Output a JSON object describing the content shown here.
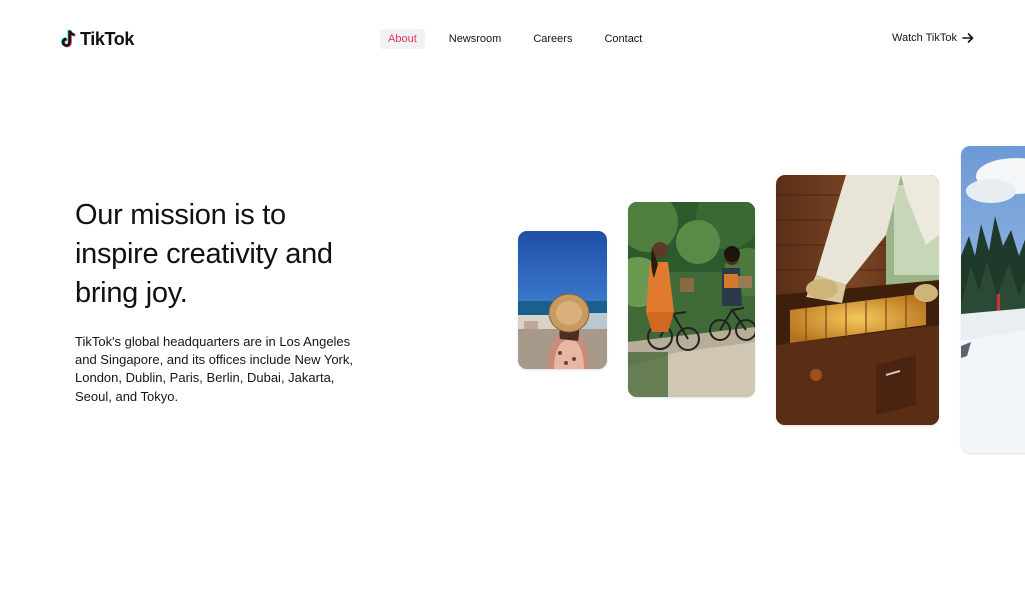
{
  "brand": {
    "name": "TikTok",
    "icon": "tiktok-note-icon",
    "colors": {
      "cyan": "#25F4EE",
      "pink": "#FE2C55",
      "ink": "#111111"
    }
  },
  "nav": {
    "items": [
      {
        "label": "About",
        "active": true
      },
      {
        "label": "Newsroom",
        "active": false
      },
      {
        "label": "Careers",
        "active": false
      },
      {
        "label": "Contact",
        "active": false
      }
    ],
    "active_color": "#E0395A"
  },
  "watch_cta": {
    "label": "Watch TikTok",
    "icon": "arrow-right-icon"
  },
  "hero": {
    "headline": "Our mission is to inspire creativity and bring joy.",
    "body": "TikTok's global headquarters are in Los Angeles and Singapore, and its offices include New York, London, Dublin, Paris, Berlin, Dubai, Jakarta, Seoul, and Tokyo."
  },
  "gallery": [
    {
      "subject": "woman-in-sun-hat-seaside"
    },
    {
      "subject": "women-cycling-in-park"
    },
    {
      "subject": "beekeeper-with-hive"
    },
    {
      "subject": "snowy-pine-forest"
    }
  ]
}
